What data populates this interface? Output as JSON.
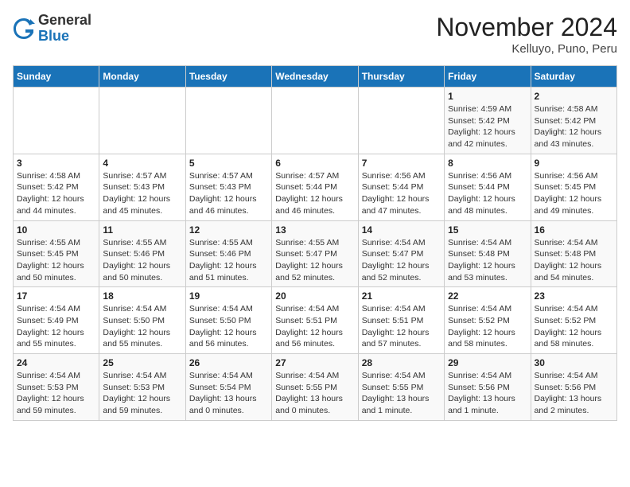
{
  "logo": {
    "general": "General",
    "blue": "Blue"
  },
  "title": "November 2024",
  "location": "Kelluyo, Puno, Peru",
  "days_header": [
    "Sunday",
    "Monday",
    "Tuesday",
    "Wednesday",
    "Thursday",
    "Friday",
    "Saturday"
  ],
  "weeks": [
    [
      {
        "day": "",
        "info": ""
      },
      {
        "day": "",
        "info": ""
      },
      {
        "day": "",
        "info": ""
      },
      {
        "day": "",
        "info": ""
      },
      {
        "day": "",
        "info": ""
      },
      {
        "day": "1",
        "info": "Sunrise: 4:59 AM\nSunset: 5:42 PM\nDaylight: 12 hours\nand 42 minutes."
      },
      {
        "day": "2",
        "info": "Sunrise: 4:58 AM\nSunset: 5:42 PM\nDaylight: 12 hours\nand 43 minutes."
      }
    ],
    [
      {
        "day": "3",
        "info": "Sunrise: 4:58 AM\nSunset: 5:42 PM\nDaylight: 12 hours\nand 44 minutes."
      },
      {
        "day": "4",
        "info": "Sunrise: 4:57 AM\nSunset: 5:43 PM\nDaylight: 12 hours\nand 45 minutes."
      },
      {
        "day": "5",
        "info": "Sunrise: 4:57 AM\nSunset: 5:43 PM\nDaylight: 12 hours\nand 46 minutes."
      },
      {
        "day": "6",
        "info": "Sunrise: 4:57 AM\nSunset: 5:44 PM\nDaylight: 12 hours\nand 46 minutes."
      },
      {
        "day": "7",
        "info": "Sunrise: 4:56 AM\nSunset: 5:44 PM\nDaylight: 12 hours\nand 47 minutes."
      },
      {
        "day": "8",
        "info": "Sunrise: 4:56 AM\nSunset: 5:44 PM\nDaylight: 12 hours\nand 48 minutes."
      },
      {
        "day": "9",
        "info": "Sunrise: 4:56 AM\nSunset: 5:45 PM\nDaylight: 12 hours\nand 49 minutes."
      }
    ],
    [
      {
        "day": "10",
        "info": "Sunrise: 4:55 AM\nSunset: 5:45 PM\nDaylight: 12 hours\nand 50 minutes."
      },
      {
        "day": "11",
        "info": "Sunrise: 4:55 AM\nSunset: 5:46 PM\nDaylight: 12 hours\nand 50 minutes."
      },
      {
        "day": "12",
        "info": "Sunrise: 4:55 AM\nSunset: 5:46 PM\nDaylight: 12 hours\nand 51 minutes."
      },
      {
        "day": "13",
        "info": "Sunrise: 4:55 AM\nSunset: 5:47 PM\nDaylight: 12 hours\nand 52 minutes."
      },
      {
        "day": "14",
        "info": "Sunrise: 4:54 AM\nSunset: 5:47 PM\nDaylight: 12 hours\nand 52 minutes."
      },
      {
        "day": "15",
        "info": "Sunrise: 4:54 AM\nSunset: 5:48 PM\nDaylight: 12 hours\nand 53 minutes."
      },
      {
        "day": "16",
        "info": "Sunrise: 4:54 AM\nSunset: 5:48 PM\nDaylight: 12 hours\nand 54 minutes."
      }
    ],
    [
      {
        "day": "17",
        "info": "Sunrise: 4:54 AM\nSunset: 5:49 PM\nDaylight: 12 hours\nand 55 minutes."
      },
      {
        "day": "18",
        "info": "Sunrise: 4:54 AM\nSunset: 5:50 PM\nDaylight: 12 hours\nand 55 minutes."
      },
      {
        "day": "19",
        "info": "Sunrise: 4:54 AM\nSunset: 5:50 PM\nDaylight: 12 hours\nand 56 minutes."
      },
      {
        "day": "20",
        "info": "Sunrise: 4:54 AM\nSunset: 5:51 PM\nDaylight: 12 hours\nand 56 minutes."
      },
      {
        "day": "21",
        "info": "Sunrise: 4:54 AM\nSunset: 5:51 PM\nDaylight: 12 hours\nand 57 minutes."
      },
      {
        "day": "22",
        "info": "Sunrise: 4:54 AM\nSunset: 5:52 PM\nDaylight: 12 hours\nand 58 minutes."
      },
      {
        "day": "23",
        "info": "Sunrise: 4:54 AM\nSunset: 5:52 PM\nDaylight: 12 hours\nand 58 minutes."
      }
    ],
    [
      {
        "day": "24",
        "info": "Sunrise: 4:54 AM\nSunset: 5:53 PM\nDaylight: 12 hours\nand 59 minutes."
      },
      {
        "day": "25",
        "info": "Sunrise: 4:54 AM\nSunset: 5:53 PM\nDaylight: 12 hours\nand 59 minutes."
      },
      {
        "day": "26",
        "info": "Sunrise: 4:54 AM\nSunset: 5:54 PM\nDaylight: 13 hours\nand 0 minutes."
      },
      {
        "day": "27",
        "info": "Sunrise: 4:54 AM\nSunset: 5:55 PM\nDaylight: 13 hours\nand 0 minutes."
      },
      {
        "day": "28",
        "info": "Sunrise: 4:54 AM\nSunset: 5:55 PM\nDaylight: 13 hours\nand 1 minute."
      },
      {
        "day": "29",
        "info": "Sunrise: 4:54 AM\nSunset: 5:56 PM\nDaylight: 13 hours\nand 1 minute."
      },
      {
        "day": "30",
        "info": "Sunrise: 4:54 AM\nSunset: 5:56 PM\nDaylight: 13 hours\nand 2 minutes."
      }
    ]
  ]
}
